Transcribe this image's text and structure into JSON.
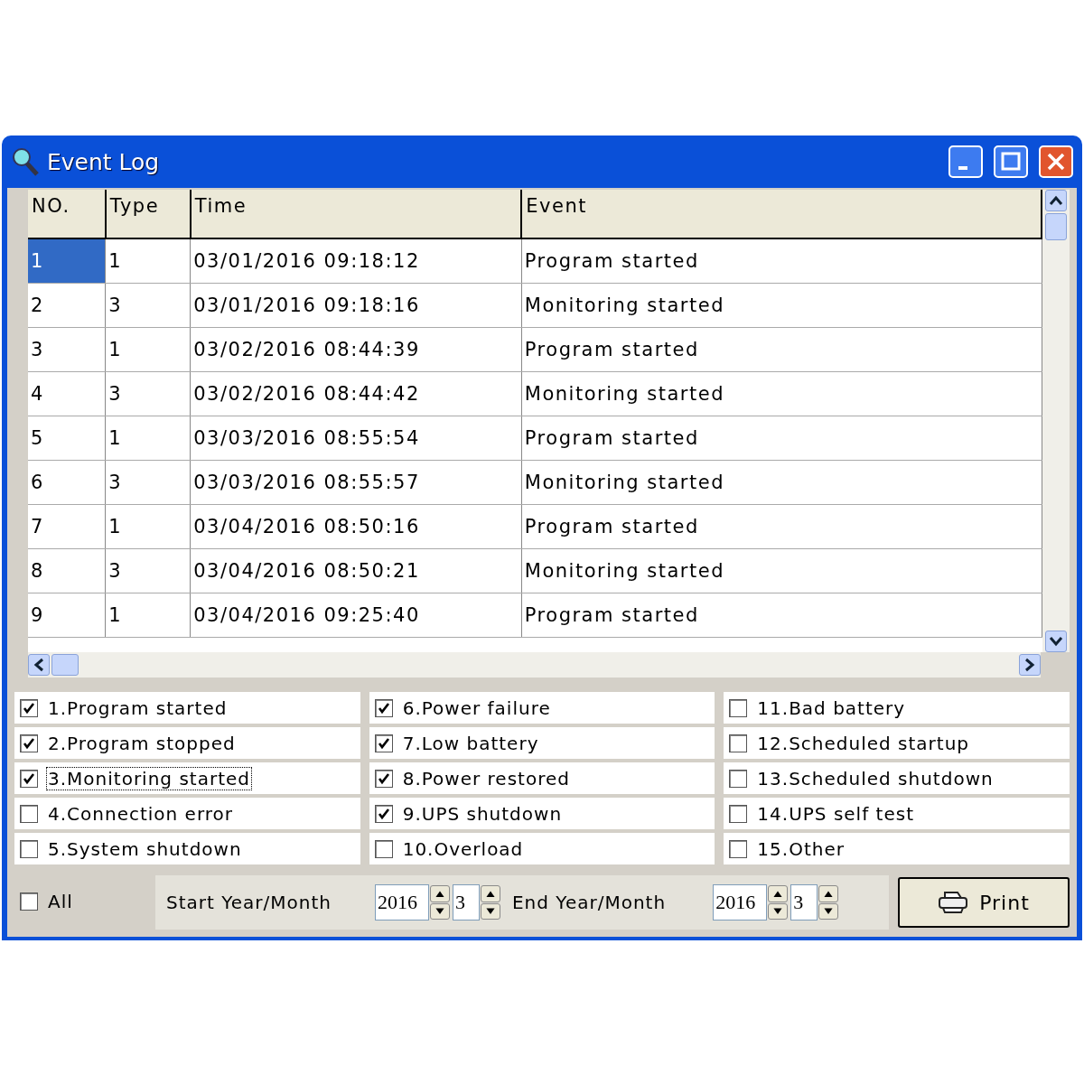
{
  "window": {
    "title": "Event Log"
  },
  "table": {
    "columns": [
      "NO.",
      "Type",
      "Time",
      "Event"
    ],
    "rows": [
      {
        "cells": [
          "1",
          "1",
          "03/01/2016 09:18:12",
          "Program started"
        ],
        "selected": true
      },
      {
        "cells": [
          "2",
          "3",
          "03/01/2016 09:18:16",
          "Monitoring started"
        ],
        "selected": false
      },
      {
        "cells": [
          "3",
          "1",
          "03/02/2016 08:44:39",
          "Program started"
        ],
        "selected": false
      },
      {
        "cells": [
          "4",
          "3",
          "03/02/2016 08:44:42",
          "Monitoring started"
        ],
        "selected": false
      },
      {
        "cells": [
          "5",
          "1",
          "03/03/2016 08:55:54",
          "Program started"
        ],
        "selected": false
      },
      {
        "cells": [
          "6",
          "3",
          "03/03/2016 08:55:57",
          "Monitoring started"
        ],
        "selected": false
      },
      {
        "cells": [
          "7",
          "1",
          "03/04/2016 08:50:16",
          "Program started"
        ],
        "selected": false
      },
      {
        "cells": [
          "8",
          "3",
          "03/04/2016 08:50:21",
          "Monitoring started"
        ],
        "selected": false
      },
      {
        "cells": [
          "9",
          "1",
          "03/04/2016 09:25:40",
          "Program started"
        ],
        "selected": false
      }
    ]
  },
  "filters": [
    {
      "label": "1.Program started",
      "checked": true,
      "focused": false
    },
    {
      "label": "2.Program stopped",
      "checked": true,
      "focused": false
    },
    {
      "label": "3.Monitoring started",
      "checked": true,
      "focused": true
    },
    {
      "label": "4.Connection error",
      "checked": false,
      "focused": false
    },
    {
      "label": "5.System shutdown",
      "checked": false,
      "focused": false
    },
    {
      "label": "6.Power failure",
      "checked": true,
      "focused": false
    },
    {
      "label": "7.Low battery",
      "checked": true,
      "focused": false
    },
    {
      "label": "8.Power restored",
      "checked": true,
      "focused": false
    },
    {
      "label": "9.UPS shutdown",
      "checked": true,
      "focused": false
    },
    {
      "label": "10.Overload",
      "checked": false,
      "focused": false
    },
    {
      "label": "11.Bad battery",
      "checked": false,
      "focused": false
    },
    {
      "label": "12.Scheduled startup",
      "checked": false,
      "focused": false
    },
    {
      "label": "13.Scheduled shutdown",
      "checked": false,
      "focused": false
    },
    {
      "label": "14.UPS self test",
      "checked": false,
      "focused": false
    },
    {
      "label": "15.Other",
      "checked": false,
      "focused": false
    }
  ],
  "footer": {
    "all": {
      "label": "All",
      "checked": false
    },
    "start": {
      "label": "Start Year/Month",
      "year": "2016",
      "month": "3"
    },
    "end": {
      "label": "End Year/Month",
      "year": "2016",
      "month": "3"
    },
    "print_button": "Print"
  }
}
